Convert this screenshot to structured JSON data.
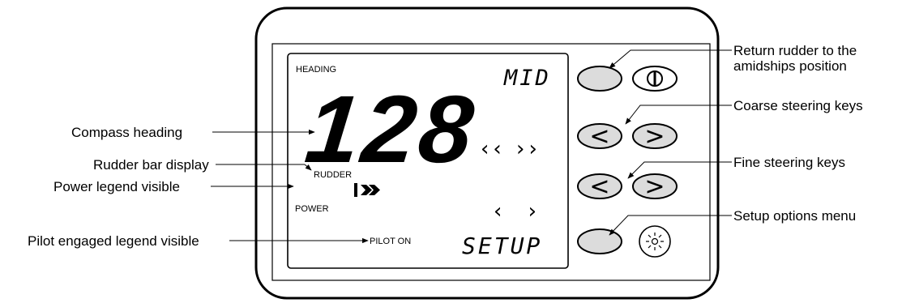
{
  "lcd": {
    "heading_legend": "HEADING",
    "heading_value": "128",
    "mode_text": "MID",
    "rudder_legend": "RUDDER",
    "power_legend": "POWER",
    "pilot_legend": "PILOT ON",
    "menu_text": "SETUP",
    "coarse_chevrons": "‹‹ ››",
    "fine_chevrons": "‹ ›"
  },
  "callouts": {
    "compass_heading": "Compass heading",
    "rudder_bar": "Rudder bar display",
    "power_legend": "Power legend visible",
    "pilot_engaged": "Pilot engaged legend visible",
    "return_rudder_line1": "Return rudder to the",
    "return_rudder_line2": "amidships position",
    "coarse_keys": "Coarse steering keys",
    "fine_keys": "Fine steering keys",
    "setup_menu": "Setup options menu"
  },
  "keys": {
    "coarse_left": "<",
    "coarse_right": ">",
    "fine_left": "<",
    "fine_right": ">"
  },
  "icons": [
    "power-icon",
    "backlight-icon",
    "rudder-bar-icon"
  ]
}
